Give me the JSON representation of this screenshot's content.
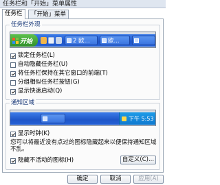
{
  "window": {
    "title": "任务栏和「开始」菜单属性"
  },
  "tabs": [
    {
      "label": "任务栏"
    },
    {
      "label": "「开始」菜单"
    }
  ],
  "appearance": {
    "legend": "任务栏外观",
    "preview": {
      "start_label": "开始",
      "task_buttons": [
        {
          "label": "2 欧..."
        },
        {
          "label": "欧..."
        }
      ]
    },
    "options": [
      {
        "label": "锁定任务栏(L)",
        "checked": true
      },
      {
        "label": "自动隐藏任务栏(U)",
        "checked": false
      },
      {
        "label": "将任务栏保持在其它窗口的前端(T)",
        "checked": true
      },
      {
        "label": "分组相似任务栏按钮(G)",
        "checked": false
      },
      {
        "label": "显示快速启动(Q)",
        "checked": true
      }
    ]
  },
  "notification": {
    "legend": "通知区域",
    "preview": {
      "clock": "下午 5:53"
    },
    "options": [
      {
        "label": "显示时钟(K)",
        "checked": true
      },
      {
        "label": "隐藏不活动的图标(H)",
        "checked": true
      }
    ],
    "description": "您可以将最近没有点过的图标隐藏起来以便保持通知区域不乱。",
    "customize_label": "自定义(C)..."
  },
  "buttons": {
    "ok": "确定",
    "cancel": "取消",
    "apply": "应用(A)"
  },
  "colors": {
    "taskbar_blue": "#1f56c8",
    "start_green": "#3ca335",
    "tray_blue": "#0f79d0",
    "legend_text": "#1a3a7a"
  }
}
